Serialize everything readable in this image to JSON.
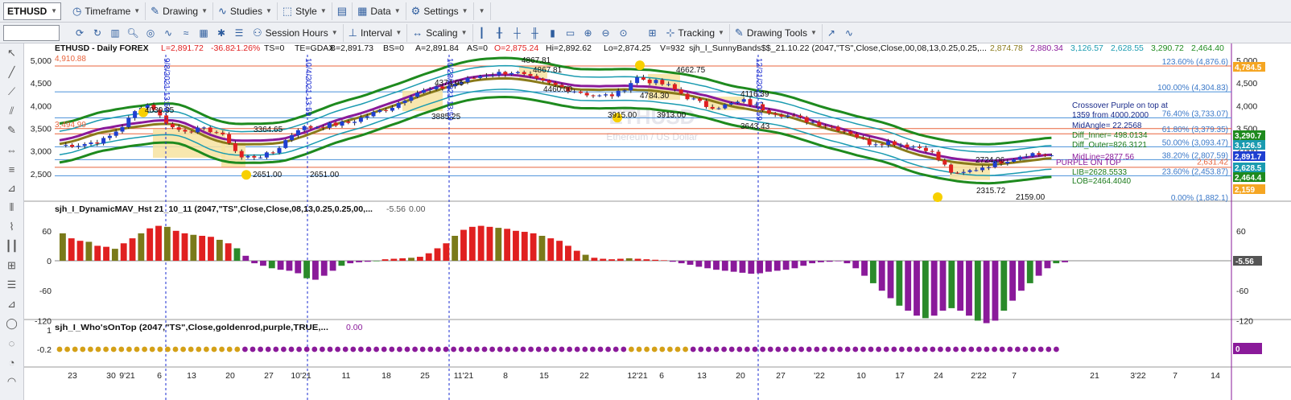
{
  "toolbar1": {
    "symbol": "ETHUSD",
    "items": [
      "Timeframe",
      "Drawing",
      "Studies",
      "Style",
      "Data",
      "Settings"
    ]
  },
  "toolbar2": {
    "items": [
      "Session Hours",
      "Interval",
      "Scaling",
      "Tracking",
      "Drawing Tools"
    ]
  },
  "header": {
    "title": "ETHUSD - Daily  FOREX",
    "last": "L=2,891.72",
    "chg": "-36.82",
    "pct": "-1.26%",
    "ts": "TS=0",
    "te": "TE=GDAX",
    "bid": "B=2,891.73",
    "bs": "BS=0",
    "ask": "A=2,891.84",
    "as": "AS=0",
    "open": "O=2,875.24",
    "high": "Hi=2,892.62",
    "low": "Lo=2,874.25",
    "vol": "V=932",
    "study": "sjh_I_SunnyBands$$_21.10.22 (2047,\"TS\",Close,Close,00,08,13,0.25,0.25,...",
    "v1": "2,874.78",
    "v2": "2,880.34",
    "v3": "3,126.57",
    "v4": "2,628.55",
    "v5": "3,290.72",
    "v6": "2,464.40",
    "watermark": "ETHUSD",
    "watermark_sub": "Ethereum / US Dollar"
  },
  "price_pane": {
    "axis_ticks": [
      "5,000",
      "4,500",
      "4,000",
      "3,500",
      "3,000",
      "2,500"
    ],
    "left_labels": [
      "4,910.88",
      "3,494.99"
    ],
    "fib_labels": [
      "123.60% (4,876.6)",
      "100.00% (4,304.83)",
      "76.40% (3,733.07)",
      "61.80% (3,379.35)",
      "50.00% (3,093.47)",
      "38.20% (2,807.59)",
      "23.60% (2,453.87)",
      "0.00% (1,882.1)"
    ],
    "annotations": [
      "4030.35",
      "3364.65",
      "2651.00",
      "2651.00",
      "4374.95",
      "3885.25",
      "4867.81",
      "4867.81",
      "4460.00",
      "4784.30",
      "4662.75",
      "3915.00",
      "3913.00",
      "4116.39",
      "3643.43",
      "2724.06",
      "2315.72",
      "2159.00"
    ],
    "dates": [
      "9/8/2021 13:59",
      "10/4/2021 13:59",
      "10/28/2021 13:59",
      "12/31/2021 13:59"
    ],
    "info_lines": [
      "Crossover Purple on top at",
      "1359 from 4000.2000",
      "MidAngle= 22.2568",
      "Diff_Inner= 498.0134",
      "Diff_Outer=826.3121",
      "MidLine=2877.56",
      "PURPLE ON TOP",
      "LIB=2628.5533",
      "LOB=2464.4040"
    ],
    "right_badges": [
      {
        "text": "4,784.5",
        "bg": "#f5a623",
        "fg": "#ffffff"
      },
      {
        "text": "3,290.7",
        "bg": "#1e8a1e",
        "fg": "#ffffff"
      },
      {
        "text": "3,126.5",
        "bg": "#1a9bb0",
        "fg": "#ffffff"
      },
      {
        "text": "2,891.7",
        "bg": "#1f3fd1",
        "fg": "#ffffff"
      },
      {
        "text": "2,628.5",
        "bg": "#1a9bb0",
        "fg": "#ffffff"
      },
      {
        "text": "2,464.4",
        "bg": "#1e8a1e",
        "fg": "#ffffff"
      },
      {
        "text": "2,159",
        "bg": "#f5a623",
        "fg": "#ffffff"
      }
    ],
    "extra_value": "2,631.42"
  },
  "hist_pane": {
    "title": "sjh_I_DynamicMAV_Hst 21_10_11 (2047,\"TS\",Close,Close,08,13,0.25,0.25,00,...",
    "v1": "-5.56",
    "v2": "0.00",
    "axis_ticks": [
      "60",
      "0",
      "-60",
      "-120"
    ],
    "badge": "-5.56"
  },
  "who_pane": {
    "title": "sjh_I_Who'sOnTop (2047,\"TS\",Close,goldenrod,purple,TRUE,...",
    "v1": "0.00",
    "axis_ticks": [
      "1",
      "-0.2"
    ],
    "badge": "0"
  },
  "time_axis": [
    "23",
    "30",
    "9'21",
    "6",
    "13",
    "20",
    "27",
    "10'21",
    "11",
    "18",
    "25",
    "11'21",
    "8",
    "15",
    "22",
    "12'21",
    "6",
    "13",
    "20",
    "27",
    "'22",
    "10",
    "17",
    "24",
    "2'22",
    "7",
    "21",
    "3'22",
    "7",
    "14"
  ],
  "colors": {
    "up": "#1f3fd1",
    "down": "#e02020",
    "outer_band": "#1e8a1e",
    "inner_band": "#1a9bb0",
    "purple": "#8a1a9a",
    "olive": "#8a7a1a",
    "gold": "#d4a017",
    "fib_orange": "#e8643c",
    "fib_blue": "#4a90d9",
    "hist_olive": "#7a7a1a",
    "hist_green": "#2a8a2a"
  }
}
